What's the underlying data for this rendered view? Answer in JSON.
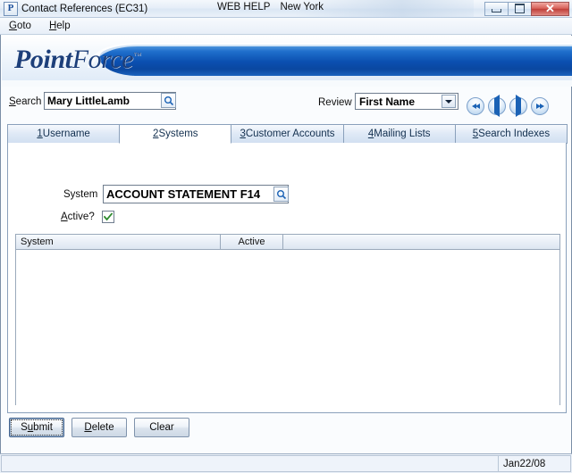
{
  "window": {
    "app_icon_letter": "P",
    "title": "Contact References (EC31)",
    "center_items": [
      "WEB HELP",
      "New York"
    ],
    "controls": {
      "minimize": "minimize-button",
      "maximize": "maximize-button",
      "close_glyph": "✕"
    }
  },
  "menubar": {
    "items": [
      {
        "mnemonic": "G",
        "rest": "oto"
      },
      {
        "mnemonic": "H",
        "rest": "elp"
      }
    ]
  },
  "banner": {
    "logo_part1": "Point",
    "logo_part2": "Force",
    "logo_tm": "™"
  },
  "search": {
    "label_mnemonic": "S",
    "label_rest": "earch",
    "value": "Mary LittleLamb",
    "placeholder": "",
    "lookup_icon": "magnifier-icon"
  },
  "review": {
    "label": "Review",
    "selected": "First Name",
    "options": [
      "First Name"
    ]
  },
  "navigation": {
    "buttons": [
      {
        "name": "first-record-button",
        "icon": "double-left-arrow-icon"
      },
      {
        "name": "previous-record-button",
        "icon": "left-arrow-icon"
      },
      {
        "name": "next-record-button",
        "icon": "right-arrow-icon"
      },
      {
        "name": "last-record-button",
        "icon": "double-right-arrow-icon"
      }
    ]
  },
  "tabs": [
    {
      "num": "1",
      "label": " Username",
      "active": false
    },
    {
      "num": "2",
      "label": " Systems",
      "active": true
    },
    {
      "num": "3",
      "label": " Customer Accounts",
      "active": false
    },
    {
      "num": "4",
      "label": " Mailing Lists",
      "active": false
    },
    {
      "num": "5",
      "label": " Search Indexes",
      "active": false
    }
  ],
  "form": {
    "system_label": "System",
    "system_value": "ACCOUNT STATEMENT F14",
    "system_lookup_icon": "magnifier-icon",
    "active_label_mnemonic": "A",
    "active_label_rest": "ctive?",
    "active_checked": true,
    "check_color": "#2e8b2e"
  },
  "grid": {
    "columns": [
      "System",
      "Active",
      ""
    ],
    "rows": []
  },
  "buttons": [
    {
      "name": "submit-button",
      "mnemonic_pre": "S",
      "mnemonic": "u",
      "mnemonic_post": "bmit",
      "focused": true
    },
    {
      "name": "delete-button",
      "mnemonic_pre": "",
      "mnemonic": "D",
      "mnemonic_post": "elete",
      "focused": false
    },
    {
      "name": "clear-button",
      "mnemonic_pre": "Clear",
      "mnemonic": "",
      "mnemonic_post": "",
      "focused": false
    }
  ],
  "statusbar": {
    "message": "",
    "date": "Jan22/08"
  },
  "colors": {
    "accent_blue": "#1b62b5",
    "banner_blue": "#0b4fb0",
    "logo_blue": "#1d3f7a",
    "title_text": "#0b0b0b"
  }
}
